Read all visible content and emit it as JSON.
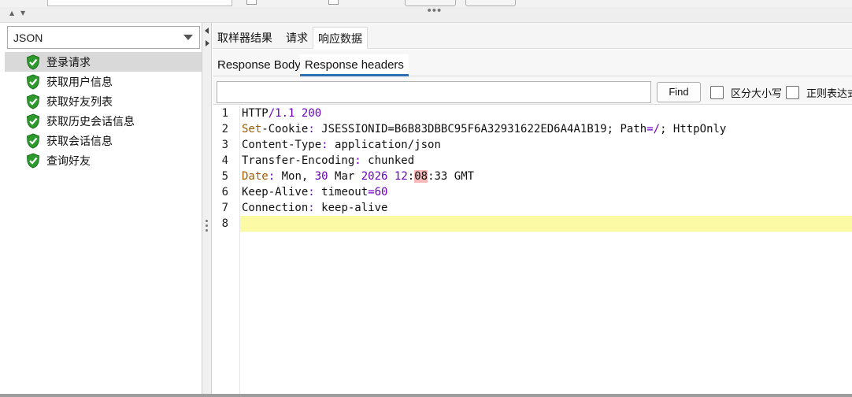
{
  "renderer": {
    "selected": "JSON"
  },
  "samplers": [
    {
      "label": "登录请求",
      "selected": true
    },
    {
      "label": "获取用户信息",
      "selected": false
    },
    {
      "label": "获取好友列表",
      "selected": false
    },
    {
      "label": "获取历史会话信息",
      "selected": false
    },
    {
      "label": "获取会话信息",
      "selected": false
    },
    {
      "label": "查询好友",
      "selected": false
    }
  ],
  "result_tabs": [
    "取样器结果",
    "请求",
    "响应数据"
  ],
  "active_result_tab": "响应数据",
  "sub_tabs": [
    "Response Body",
    "Response headers"
  ],
  "active_sub_tab": "Response headers",
  "search": {
    "value": "",
    "find_label": "Find",
    "case_label": "区分大小写",
    "regex_label": "正则表达式"
  },
  "editor": {
    "current_line": 8,
    "line_numbers": [
      "1",
      "2",
      "3",
      "4",
      "5",
      "6",
      "7",
      "8"
    ],
    "lines": [
      "HTTP/1.1 200",
      "Set-Cookie: JSESSIONID=B6B83DBBC95F6A32931622ED6A4A1B19; Path=/; HttpOnly",
      "Content-Type: application/json",
      "Transfer-Encoding: chunked",
      "Date: Mon, 30 Mar 2026 12:08:33 GMT",
      "Keep-Alive: timeout=60",
      "Connection: keep-alive",
      ""
    ]
  },
  "colors": {
    "current_line": "#fdfaa5",
    "active_tab_underline": "#2f6fb0",
    "success_icon": "#2e9a2e"
  }
}
